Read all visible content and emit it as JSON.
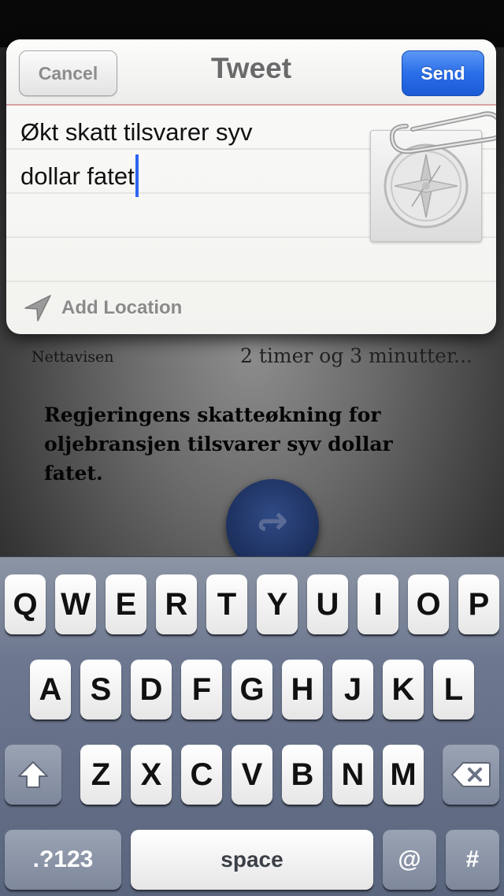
{
  "background": {
    "topbar_title": "",
    "source": "Nettavisen",
    "time": "2 timer og 3 minutter...",
    "headline": "Regjeringens skatteøkning for oljebransjen tilsvarer syv dollar fatet."
  },
  "sheet": {
    "title": "Tweet",
    "cancel_label": "Cancel",
    "send_label": "Send",
    "compose_line1": "Økt skatt tilsvarer syv",
    "compose_line2": "dollar fatet",
    "location_label": "Add Location"
  },
  "keyboard": {
    "row1": [
      "Q",
      "W",
      "E",
      "R",
      "T",
      "Y",
      "U",
      "I",
      "O",
      "P"
    ],
    "row2": [
      "A",
      "S",
      "D",
      "F",
      "G",
      "H",
      "J",
      "K",
      "L"
    ],
    "row3": [
      "Z",
      "X",
      "C",
      "V",
      "B",
      "N",
      "M"
    ],
    "numbers_label": ".?123",
    "space_label": "space",
    "at_label": "@",
    "hash_label": "#"
  },
  "colors": {
    "send_blue": "#2a6ee8",
    "cursor_blue": "#2c64f0",
    "keyboard_bg": "#6d7890"
  }
}
